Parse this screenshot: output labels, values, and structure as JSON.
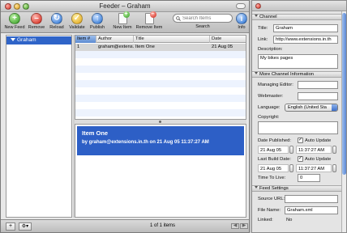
{
  "window": {
    "title": "Feeder – Graham"
  },
  "toolbar": {
    "new_feed": "New Feed",
    "remove": "Remove",
    "reload": "Reload",
    "validate": "Validate",
    "publish": "Publish",
    "new_item": "New Item",
    "remove_item": "Remove Item",
    "search_label": "Search",
    "search_placeholder": "Search Items",
    "info": "Info"
  },
  "sidebar": {
    "items": [
      {
        "label": "Graham"
      }
    ]
  },
  "table": {
    "columns": [
      "Item #",
      "Author",
      "Title",
      "Date"
    ],
    "sort_indicator": "▲",
    "rows": [
      {
        "num": "1",
        "author": "graham@extens...",
        "title": "Item One",
        "date": "21 Aug 05"
      }
    ]
  },
  "preview": {
    "title": "Item One",
    "meta": "by graham@extensions.in.th on 21 Aug 05 11:37:27 AM"
  },
  "bottombar": {
    "add": "+",
    "action": "⚙▾",
    "count": "1 of 1 items"
  },
  "inspector": {
    "channel": {
      "header": "Channel",
      "title_label": "Title:",
      "title_value": "Graham",
      "link_label": "Link:",
      "link_value": "http://www.extensions.in.th",
      "description_label": "Description:",
      "description_value": "My bikes pages"
    },
    "more": {
      "header": "More Channel Information",
      "managing_editor_label": "Managing Editor:",
      "webmaster_label": "Webmaster:",
      "language_label": "Language:",
      "language_value": "English (United Sta",
      "copyright_label": "Copyright:",
      "date_published_label": "Date Published:",
      "auto_update_label": "Auto Update",
      "date_published_date": "21 Aug 05",
      "date_published_time": "11:37:27 AM",
      "last_build_label": "Last Build Date:",
      "last_build_date": "21 Aug 05",
      "last_build_time": "11:37:27 AM",
      "ttl_label": "Time To Live:",
      "ttl_value": "0"
    },
    "feed": {
      "header": "Feed Settings",
      "source_url_label": "Source URL:",
      "file_name_label": "File Name:",
      "file_name_value": "Graham.xml",
      "linked_label": "Linked:",
      "linked_value": "No"
    }
  },
  "colors": {
    "selection": "#2f64c8",
    "preview_bg": "#2d5fc6",
    "row_alt": "#edf3fe"
  }
}
